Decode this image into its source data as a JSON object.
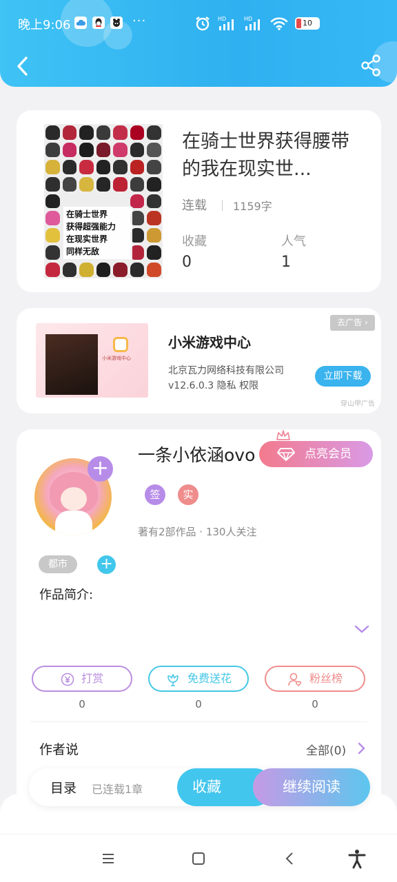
{
  "status_bar": {
    "time": "晚上9:06",
    "more": "···",
    "battery": "10",
    "hd1": "HD",
    "hd2": "HD"
  },
  "book": {
    "title": "在骑士世界获得腰带的我在现实世...",
    "status": "连载",
    "word_count": "1159字",
    "favorites_label": "收藏",
    "favorites_value": "0",
    "popularity_label": "人气",
    "popularity_value": "1",
    "cover_text": [
      "在骑士世界",
      "获得超强能力",
      "在现实世界",
      "同样无敌"
    ]
  },
  "ad": {
    "remove_label": "去广告",
    "title": "小米游戏中心",
    "company": "北京瓦力网络科技有限公司",
    "meta": "v12.6.0.3  隐私  权限",
    "download_label": "立即下载",
    "source": "穿山甲广告",
    "image_app": "小米游戏中心"
  },
  "author": {
    "name": "一条小依涵ovo",
    "vip_label": "点亮会员",
    "badge_sign": "签",
    "badge_real": "实",
    "stats": "著有2部作品 · 130人关注",
    "tag": "都市",
    "intro_label": "作品简介:",
    "actions": [
      {
        "label": "打赏",
        "count": "0",
        "color": "#b98ee0"
      },
      {
        "label": "免费送花",
        "count": "0",
        "color": "#45c7e7"
      },
      {
        "label": "粉丝榜",
        "count": "0",
        "color": "#ef8c8c"
      }
    ],
    "author_says_label": "作者说",
    "author_says_all": "全部(0)"
  },
  "bottom_bar": {
    "toc_label": "目录",
    "serialized": "已连载1章",
    "favorite_label": "收藏",
    "continue_label": "继续阅读"
  },
  "colors": {
    "header": "#33b8f3",
    "accent_purple": "#b78ce8",
    "accent_cyan": "#42c7ec"
  }
}
